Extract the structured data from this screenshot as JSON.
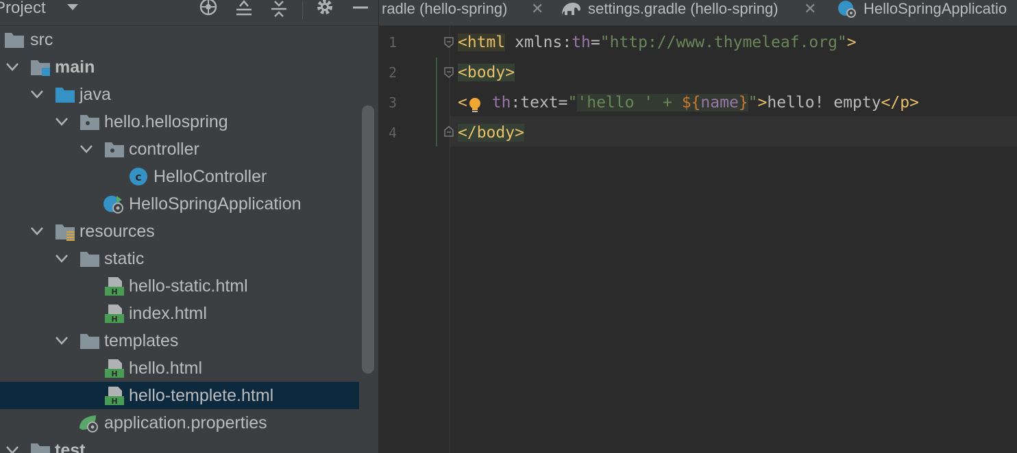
{
  "project_panel": {
    "title": "Project",
    "tree": [
      {
        "label": "src",
        "icon": "folder-icon",
        "expanded": null
      },
      {
        "label": "main",
        "icon": "source-root-folder-icon",
        "expanded": true
      },
      {
        "label": "java",
        "icon": "java-folder-icon",
        "expanded": true
      },
      {
        "label": "hello.hellospring",
        "icon": "package-icon",
        "expanded": true
      },
      {
        "label": "controller",
        "icon": "package-icon",
        "expanded": true
      },
      {
        "label": "HelloController",
        "icon": "class-icon",
        "expanded": null
      },
      {
        "label": "HelloSpringApplication",
        "icon": "spring-boot-class-icon",
        "expanded": null
      },
      {
        "label": "resources",
        "icon": "resources-folder-icon",
        "expanded": true
      },
      {
        "label": "static",
        "icon": "folder-icon",
        "expanded": true
      },
      {
        "label": "hello-static.html",
        "icon": "html-file-icon",
        "expanded": null
      },
      {
        "label": "index.html",
        "icon": "html-file-icon",
        "expanded": null
      },
      {
        "label": "templates",
        "icon": "folder-icon",
        "expanded": true
      },
      {
        "label": "hello.html",
        "icon": "html-file-icon",
        "expanded": null
      },
      {
        "label": "hello-templete.html",
        "icon": "html-file-icon",
        "expanded": null,
        "selected": true
      },
      {
        "label": "application.properties",
        "icon": "spring-properties-icon",
        "expanded": null
      },
      {
        "label": "test",
        "icon": "test-folder-icon",
        "expanded": false
      }
    ]
  },
  "tabs": [
    {
      "label": "radle (hello-spring)",
      "icon": null
    },
    {
      "label": "settings.gradle (hello-spring)",
      "icon": "gradle-elephant-icon"
    },
    {
      "label": "HelloSpringApplicatio",
      "icon": "spring-boot-class-icon"
    }
  ],
  "editor": {
    "line_numbers": [
      "1",
      "2",
      "3",
      "4"
    ],
    "lines": {
      "l1": {
        "tag_open": "<html",
        "attr": " xmlns:",
        "ns": "th",
        "eq": "=",
        "str": "\"http://www.thymeleaf.org\"",
        "close": ">"
      },
      "l2": {
        "text": "<body>"
      },
      "l3": {
        "lt": "<",
        "ns": "th",
        "attr": ":text=",
        "q1": "\"",
        "expr1": "'hello ' + ",
        "expr2": "${",
        "expr3": "name",
        "expr4": "}",
        "q2": "\"",
        "gt": ">",
        "content": "hello! empty",
        "close": "</p>"
      },
      "l4": {
        "text": "</body>"
      }
    }
  }
}
